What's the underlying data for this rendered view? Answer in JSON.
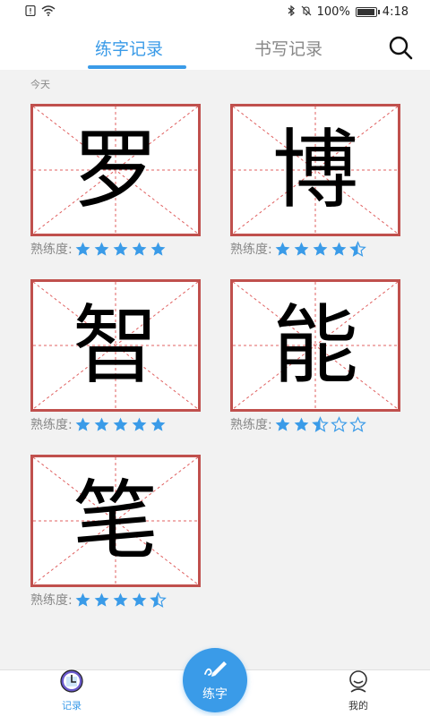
{
  "status_bar": {
    "time": "4:18",
    "battery_text": "100%",
    "battery_level": 1.0
  },
  "top_nav": {
    "tabs": [
      {
        "label": "练字记录",
        "active": true
      },
      {
        "label": "书写记录",
        "active": false
      }
    ],
    "search_icon": "search-icon"
  },
  "section": {
    "label": "今天"
  },
  "proficiency_label": "熟练度:",
  "cards": [
    {
      "char": "罗",
      "rating": 5
    },
    {
      "char": "博",
      "rating": 4.5
    },
    {
      "char": "智",
      "rating": 5
    },
    {
      "char": "能",
      "rating": 2.5
    },
    {
      "char": "笔",
      "rating": 4.5
    }
  ],
  "max_rating": 5,
  "colors": {
    "accent": "#3a9be8",
    "grid_border": "#c0504d",
    "grid_guides": "#e06060",
    "star": "#3a9be8"
  },
  "bottom_nav": {
    "record": {
      "label": "记录",
      "icon": "record-icon"
    },
    "practice": {
      "label": "练字",
      "icon": "pen-icon"
    },
    "mine": {
      "label": "我的",
      "icon": "profile-icon"
    }
  }
}
